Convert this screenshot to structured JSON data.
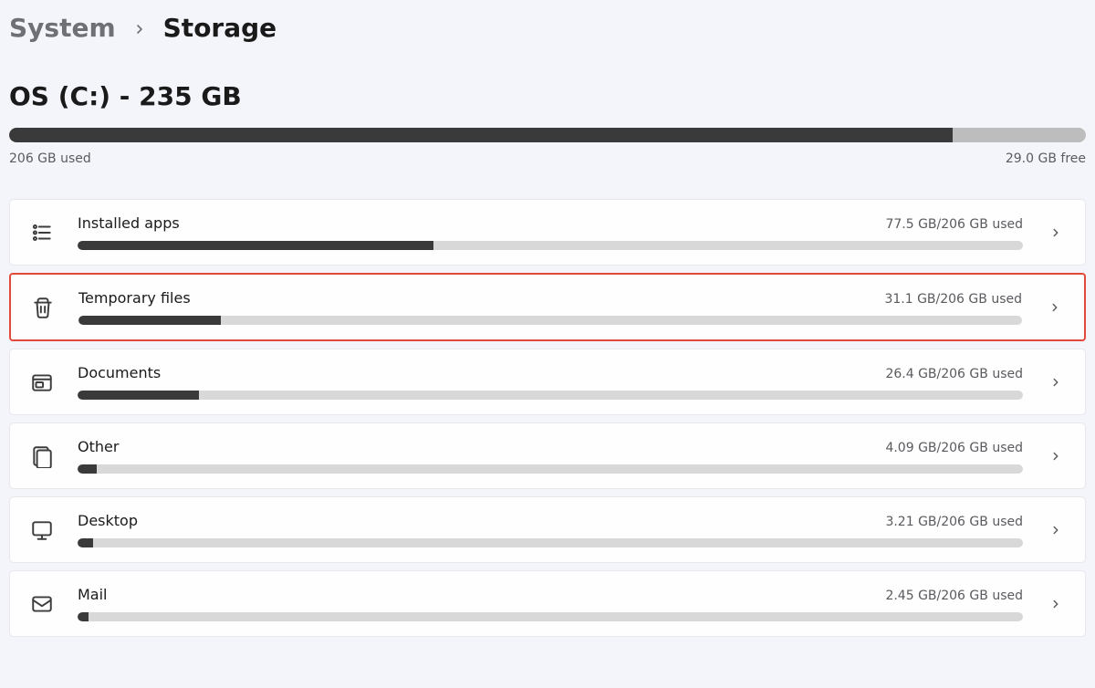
{
  "breadcrumb": {
    "parent": "System",
    "current": "Storage"
  },
  "drive": {
    "title": "OS (C:) - 235 GB",
    "used_label": "206 GB used",
    "free_label": "29.0 GB free",
    "fill_pct": 87.6
  },
  "categories": [
    {
      "id": "installed-apps",
      "icon": "apps",
      "label": "Installed apps",
      "usage": "77.5 GB/206 GB used",
      "fill_pct": 37.6,
      "highlight": false
    },
    {
      "id": "temporary-files",
      "icon": "trash",
      "label": "Temporary files",
      "usage": "31.1 GB/206 GB used",
      "fill_pct": 15.1,
      "highlight": true
    },
    {
      "id": "documents",
      "icon": "document",
      "label": "Documents",
      "usage": "26.4 GB/206 GB used",
      "fill_pct": 12.8,
      "highlight": false
    },
    {
      "id": "other",
      "icon": "other",
      "label": "Other",
      "usage": "4.09 GB/206 GB used",
      "fill_pct": 2.0,
      "highlight": false
    },
    {
      "id": "desktop",
      "icon": "desktop",
      "label": "Desktop",
      "usage": "3.21 GB/206 GB used",
      "fill_pct": 1.6,
      "highlight": false
    },
    {
      "id": "mail",
      "icon": "mail",
      "label": "Mail",
      "usage": "2.45 GB/206 GB used",
      "fill_pct": 1.2,
      "highlight": false
    }
  ]
}
